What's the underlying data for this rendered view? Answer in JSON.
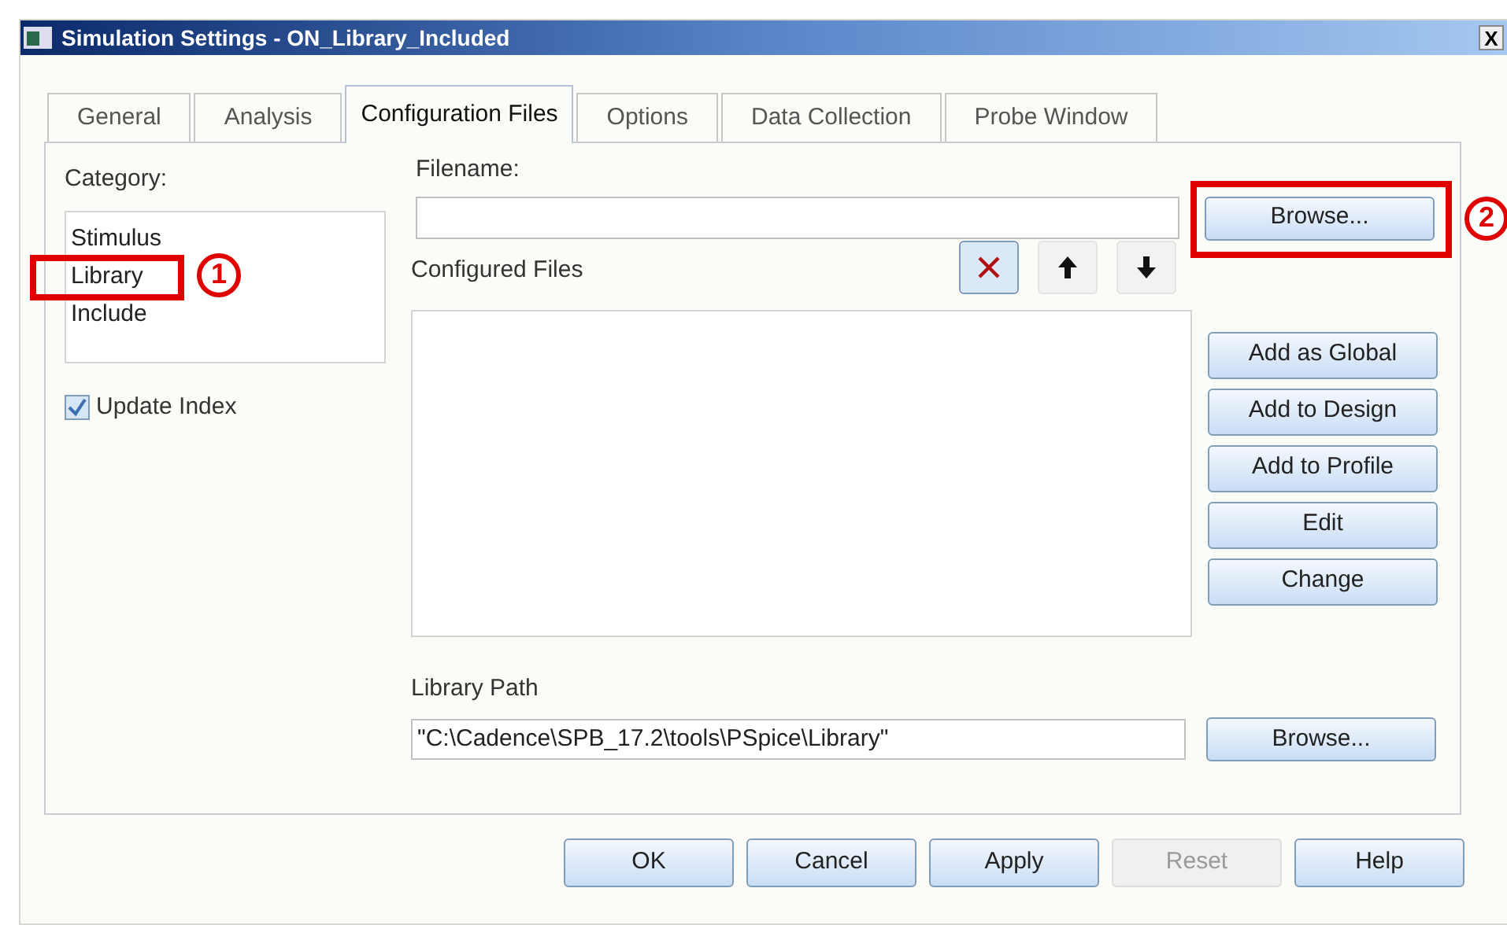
{
  "window": {
    "title": "Simulation Settings - ON_Library_Included",
    "close": "X"
  },
  "tabs": [
    {
      "label": "General",
      "selected": false
    },
    {
      "label": "Analysis",
      "selected": false
    },
    {
      "label": "Configuration Files",
      "selected": true
    },
    {
      "label": "Options",
      "selected": false
    },
    {
      "label": "Data Collection",
      "selected": false
    },
    {
      "label": "Probe Window",
      "selected": false
    }
  ],
  "category": {
    "label": "Category:",
    "items": [
      {
        "label": "Stimulus"
      },
      {
        "label": "Library",
        "callout": "1"
      },
      {
        "label": "Include"
      }
    ]
  },
  "update_index": {
    "label": "Update Index",
    "checked": true
  },
  "filename": {
    "label": "Filename:",
    "browse": {
      "label": "Browse...",
      "callout": "2"
    }
  },
  "configured_files": {
    "label": "Configured Files",
    "tools": [
      {
        "kind": "delete"
      },
      {
        "kind": "up"
      },
      {
        "kind": "down"
      }
    ]
  },
  "side_buttons": [
    "Add as Global",
    "Add to Design",
    "Add to Profile",
    "Edit",
    "Change"
  ],
  "library_path": {
    "label": "Library Path",
    "value": "\"C:\\Cadence\\SPB_17.2\\tools\\PSpice\\Library\"",
    "browse": "Browse..."
  },
  "buttons": [
    {
      "label": "OK",
      "disabled": false
    },
    {
      "label": "Cancel",
      "disabled": false
    },
    {
      "label": "Apply",
      "disabled": false
    },
    {
      "label": "Reset",
      "disabled": true
    },
    {
      "label": "Help",
      "disabled": false
    }
  ]
}
